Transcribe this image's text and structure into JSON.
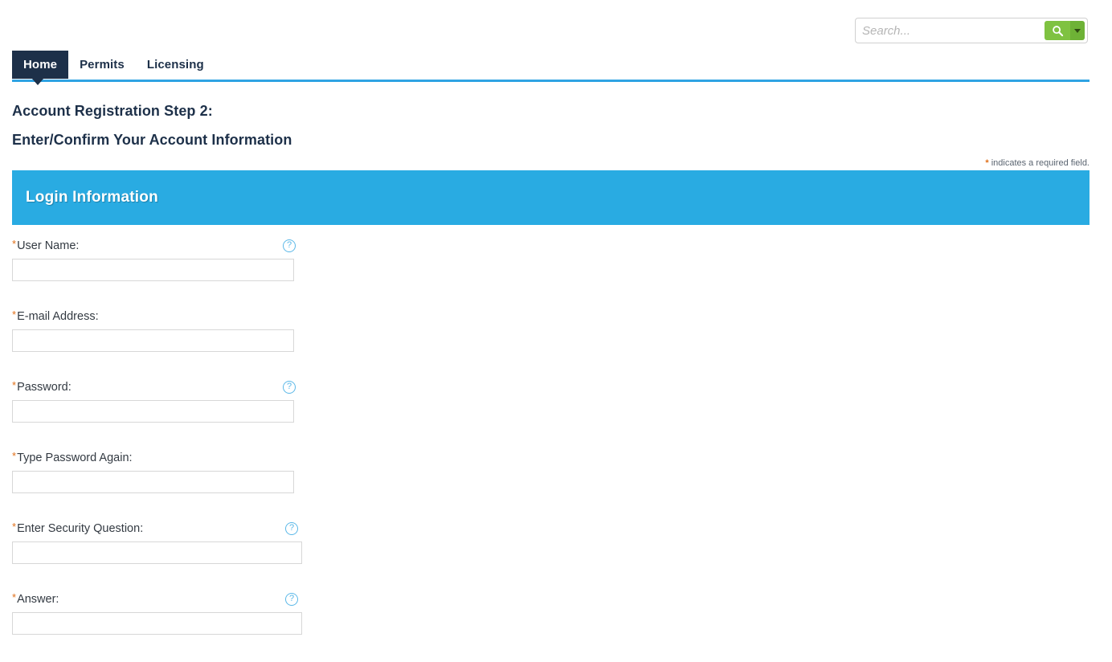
{
  "search": {
    "placeholder": "Search...",
    "value": "",
    "search_icon": "search-icon",
    "dropdown_icon": "chevron-down-icon",
    "button_color": "#7fc241",
    "dropdown_color": "#6eb236"
  },
  "nav": {
    "items": [
      {
        "label": "Home",
        "active": true
      },
      {
        "label": "Permits",
        "active": false
      },
      {
        "label": "Licensing",
        "active": false
      }
    ],
    "active_bg": "#1d3049",
    "underline_color": "#2fa3e3"
  },
  "headings": {
    "line1": "Account Registration Step 2:",
    "line2": "Enter/Confirm Your Account Information",
    "color": "#1d3049"
  },
  "required_note": {
    "star": "*",
    "text": " indicates a required field.",
    "star_color": "#e0701a"
  },
  "section": {
    "title": "Login Information",
    "bg_color": "#29abe2"
  },
  "form": {
    "fields": [
      {
        "label": "User Name:",
        "required": true,
        "value": "",
        "has_help": true,
        "help_glyph": "?"
      },
      {
        "label": "E-mail Address:",
        "required": true,
        "value": "",
        "has_help": false,
        "help_glyph": ""
      },
      {
        "label": "Password:",
        "required": true,
        "value": "",
        "has_help": true,
        "help_glyph": "?"
      },
      {
        "label": "Type Password Again:",
        "required": true,
        "value": "",
        "has_help": false,
        "help_glyph": ""
      },
      {
        "label": "Enter Security Question:",
        "required": true,
        "value": "",
        "has_help": true,
        "help_glyph": "?"
      },
      {
        "label": "Answer:",
        "required": true,
        "value": "",
        "has_help": true,
        "help_glyph": "?"
      }
    ]
  }
}
